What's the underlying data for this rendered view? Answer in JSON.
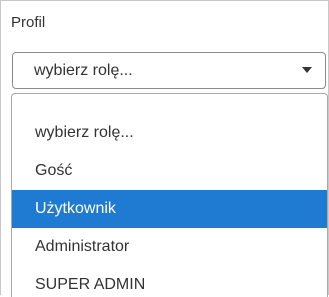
{
  "profile": {
    "label": "Profil",
    "select": {
      "selected_value": "wybierz rolę...",
      "caret_icon": "caret-down-icon"
    },
    "dropdown": {
      "options": [
        "wybierz rolę...",
        "Gość",
        "Użytkownik",
        "Administrator",
        "SUPER ADMIN"
      ],
      "highlighted_option": "Użytkownik"
    }
  },
  "colors": {
    "highlight": "#1e7bd1",
    "highlight_text": "#ffffff",
    "text": "#333333"
  }
}
